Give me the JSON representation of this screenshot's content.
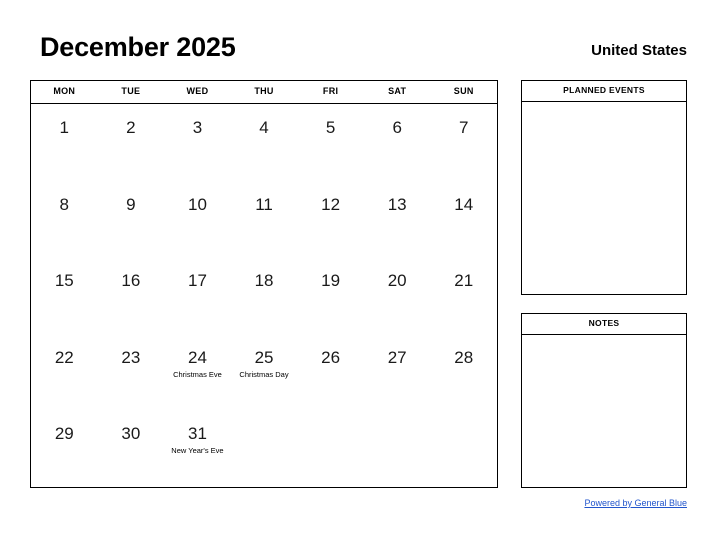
{
  "header": {
    "month_title": "December 2025",
    "country": "United States"
  },
  "calendar": {
    "weekday_headers": [
      "MON",
      "TUE",
      "WED",
      "THU",
      "FRI",
      "SAT",
      "SUN"
    ],
    "weeks": [
      [
        {
          "day": "1",
          "event": ""
        },
        {
          "day": "2",
          "event": ""
        },
        {
          "day": "3",
          "event": ""
        },
        {
          "day": "4",
          "event": ""
        },
        {
          "day": "5",
          "event": ""
        },
        {
          "day": "6",
          "event": ""
        },
        {
          "day": "7",
          "event": ""
        }
      ],
      [
        {
          "day": "8",
          "event": ""
        },
        {
          "day": "9",
          "event": ""
        },
        {
          "day": "10",
          "event": ""
        },
        {
          "day": "11",
          "event": ""
        },
        {
          "day": "12",
          "event": ""
        },
        {
          "day": "13",
          "event": ""
        },
        {
          "day": "14",
          "event": ""
        }
      ],
      [
        {
          "day": "15",
          "event": ""
        },
        {
          "day": "16",
          "event": ""
        },
        {
          "day": "17",
          "event": ""
        },
        {
          "day": "18",
          "event": ""
        },
        {
          "day": "19",
          "event": ""
        },
        {
          "day": "20",
          "event": ""
        },
        {
          "day": "21",
          "event": ""
        }
      ],
      [
        {
          "day": "22",
          "event": ""
        },
        {
          "day": "23",
          "event": ""
        },
        {
          "day": "24",
          "event": "Christmas Eve"
        },
        {
          "day": "25",
          "event": "Christmas Day"
        },
        {
          "day": "26",
          "event": ""
        },
        {
          "day": "27",
          "event": ""
        },
        {
          "day": "28",
          "event": ""
        }
      ],
      [
        {
          "day": "29",
          "event": ""
        },
        {
          "day": "30",
          "event": ""
        },
        {
          "day": "31",
          "event": "New Year's Eve"
        },
        {
          "day": "",
          "event": ""
        },
        {
          "day": "",
          "event": ""
        },
        {
          "day": "",
          "event": ""
        },
        {
          "day": "",
          "event": ""
        }
      ]
    ]
  },
  "panels": {
    "planned_events_title": "PLANNED EVENTS",
    "planned_events_body": "",
    "notes_title": "NOTES",
    "notes_body": ""
  },
  "footer": {
    "link_text": "Powered by General Blue",
    "link_color": "#2255cc"
  }
}
